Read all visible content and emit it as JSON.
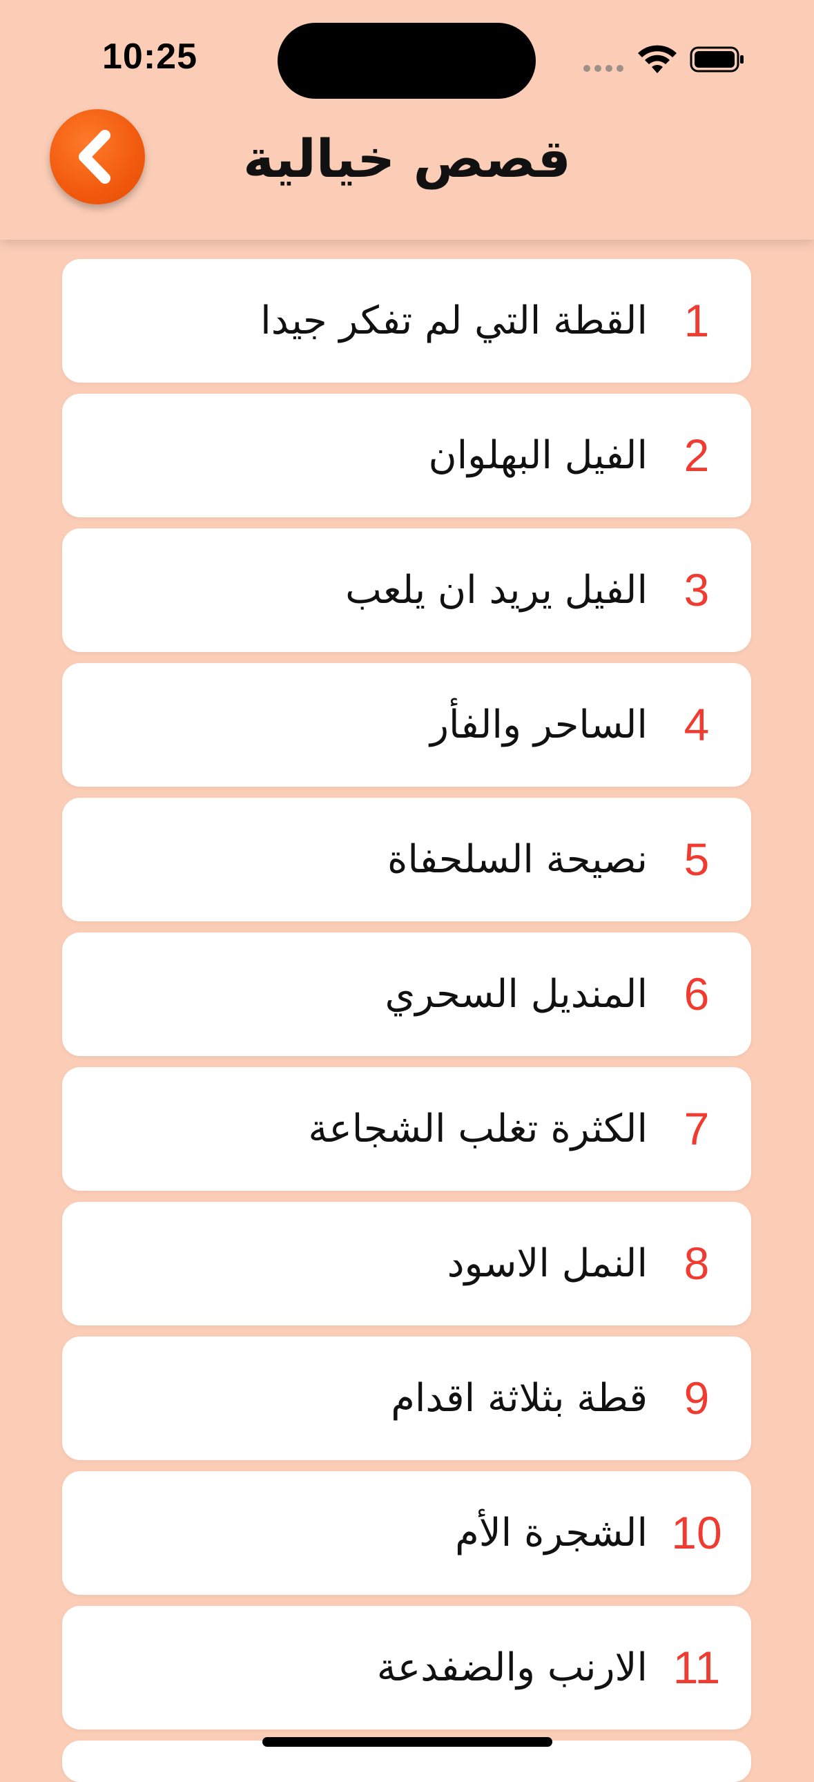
{
  "status_bar": {
    "time": "10:25",
    "wifi_icon": "wifi-icon",
    "battery_icon": "battery-full-icon"
  },
  "header": {
    "title": "قصص خيالية",
    "back_icon": "chevron-left-icon",
    "accent_color": "#f15a0e"
  },
  "colors": {
    "background": "#fbcdb7",
    "card": "#ffffff",
    "number": "#f03b30"
  },
  "stories": [
    {
      "number": "1",
      "title": "القطة التي لم تفكر جيدا"
    },
    {
      "number": "2",
      "title": "الفيل البهلوان"
    },
    {
      "number": "3",
      "title": "الفيل يريد ان يلعب"
    },
    {
      "number": "4",
      "title": "الساحر والفأر"
    },
    {
      "number": "5",
      "title": "نصيحة السلحفاة"
    },
    {
      "number": "6",
      "title": "المنديل السحري"
    },
    {
      "number": "7",
      "title": "الكثرة تغلب الشجاعة"
    },
    {
      "number": "8",
      "title": "النمل الاسود"
    },
    {
      "number": "9",
      "title": "قطة بثلاثة اقدام"
    },
    {
      "number": "10",
      "title": "الشجرة الأم"
    },
    {
      "number": "11",
      "title": "الارنب والضفدعة"
    }
  ]
}
